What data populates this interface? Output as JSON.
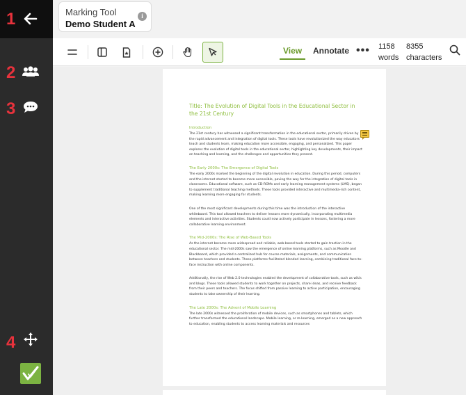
{
  "sidebar": {
    "markers": [
      "1",
      "2",
      "3",
      "4"
    ],
    "icons": {
      "back": "arrow-left-icon",
      "users": "users-icon",
      "comments": "comment-icon",
      "move": "move-icon",
      "logo": "checkmark-logo"
    },
    "colors": {
      "marker": "#e8323c",
      "background": "#2b2b2b",
      "logo": "#7cb342"
    }
  },
  "header": {
    "tool_name": "Marking Tool",
    "student_name": "Demo Student A",
    "info_glyph": "i"
  },
  "toolbar": {
    "icons": [
      "menu-icon",
      "sidebar-panel-icon",
      "document-star-icon",
      "zoom-in-icon",
      "hand-pan-icon",
      "cursor-select-icon"
    ],
    "tabs": {
      "view": "View",
      "annotate": "Annotate"
    },
    "more": "•••",
    "words_value": "1158",
    "words_label": "words",
    "chars_value": "8355",
    "chars_label": "characters",
    "accent": "#6a9a2a"
  },
  "document": {
    "title": "Title: The Evolution of Digital Tools in the Educational Sector in the 21st Century",
    "sections": [
      {
        "heading": "Introduction",
        "paragraphs": [
          "The 21st century has witnessed a significant transformation in the educational sector, primarily driven by the rapid advancement and integration of digital tools. These tools have revolutionized the way educators teach and students learn, making education more accessible, engaging, and personalized. This paper explores the evolution of digital tools in the educational sector, highlighting key developments, their impact on teaching and learning, and the challenges and opportunities they present."
        ]
      },
      {
        "heading": "The Early 2000s: The Emergence of Digital Tools",
        "paragraphs": [
          "The early 2000s marked the beginning of the digital revolution in education. During this period, computers and the internet started to become more accessible, paving the way for the integration of digital tools in classrooms. Educational software, such as CD-ROMs and early learning management systems (LMS), began to supplement traditional teaching methods. These tools provided interactive and multimedia-rich content, making learning more engaging for students.",
          "One of the most significant developments during this time was the introduction of the interactive whiteboard. This tool allowed teachers to deliver lessons more dynamically, incorporating multimedia elements and interactive activities. Students could now actively participate in lessons, fostering a more collaborative learning environment."
        ]
      },
      {
        "heading": "The Mid-2000s: The Rise of Web-Based Tools",
        "paragraphs": [
          "As the internet became more widespread and reliable, web-based tools started to gain traction in the educational sector. The mid-2000s saw the emergence of online learning platforms, such as Moodle and Blackboard, which provided a centralized hub for course materials, assignments, and communication between teachers and students. These platforms facilitated blended learning, combining traditional face-to-face instruction with online components.",
          "Additionally, the rise of Web 2.0 technologies enabled the development of collaborative tools, such as wikis and blogs. These tools allowed students to work together on projects, share ideas, and receive feedback from their peers and teachers. The focus shifted from passive learning to active participation, encouraging students to take ownership of their learning."
        ]
      },
      {
        "heading": "The Late 2000s: The Advent of Mobile Learning",
        "paragraphs": [
          "The late 2000s witnessed the proliferation of mobile devices, such as smartphones and tablets, which further transformed the educational landscape. Mobile learning, or m-learning, emerged as a new approach to education, enabling students to access learning materials and resources"
        ]
      }
    ],
    "accent": "#8dbd3c",
    "comment_icon": "comment-note-icon"
  }
}
